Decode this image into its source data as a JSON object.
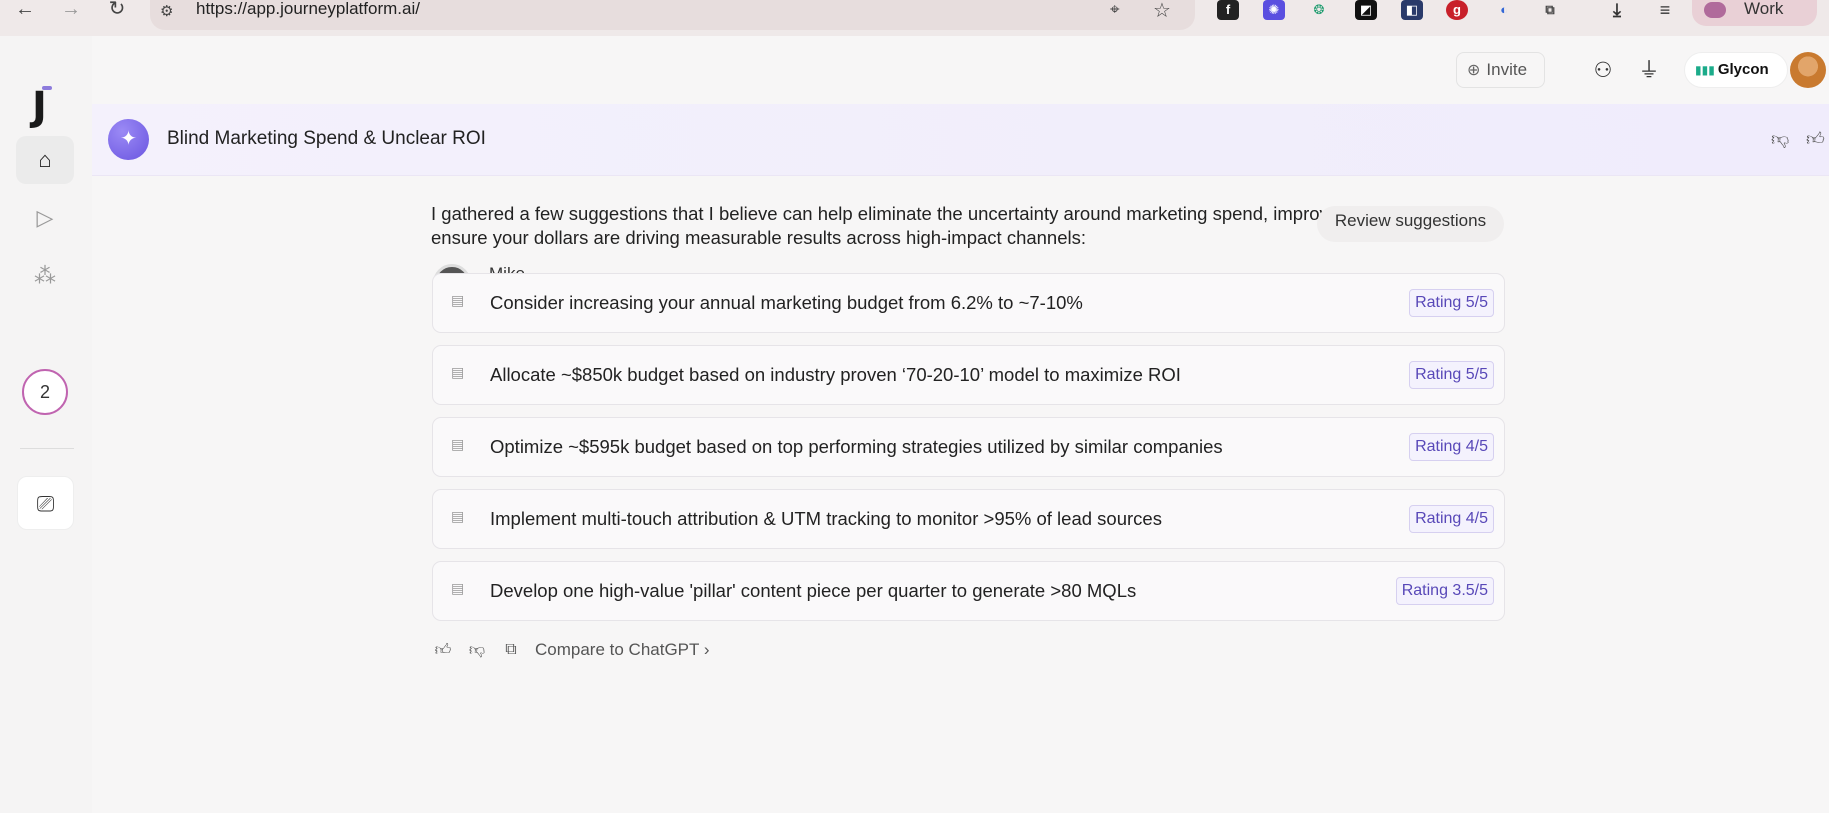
{
  "browser": {
    "url": "https://app.journeyplatform.ai/",
    "back_icon": "←",
    "forward_icon": "→",
    "reload_icon": "↻",
    "profile_label": "Work"
  },
  "app": {
    "logo_letter": "J",
    "invite_label": "Invite",
    "account_name": "Glycon",
    "rail_badge_count": "2"
  },
  "header": {
    "title": "Blind Marketing Spend & Unclear ROI"
  },
  "content": {
    "intro_text": "I gathered a few suggestions that I believe can help eliminate the uncertainty around marketing spend, improve attribution, and ensure your dollars are driving measurable results across high-impact channels:",
    "review_button_label": "Review suggestions",
    "author_name": "Mike",
    "suggestions": [
      {
        "text": "Consider increasing your annual marketing budget from 6.2% to ~7-10%",
        "rating": "Rating 5/5"
      },
      {
        "text": "Allocate ~$850k budget based on industry proven ‘70-20-10’ model to maximize ROI",
        "rating": "Rating 5/5"
      },
      {
        "text": "Optimize ~$595k budget based on top performing strategies utilized by similar companies",
        "rating": "Rating 4/5"
      },
      {
        "text": "Implement multi-touch attribution & UTM tracking to monitor >95% of lead sources",
        "rating": "Rating 4/5"
      },
      {
        "text": "Develop one high-value 'pillar' content piece per quarter to generate >80 MQLs",
        "rating": "Rating 3.5/5"
      }
    ],
    "compare_label": "Compare to ChatGPT"
  },
  "colors": {
    "accent": "#6a55e0",
    "rating_text": "#5848b8",
    "badge_ring": "#c064b0"
  }
}
